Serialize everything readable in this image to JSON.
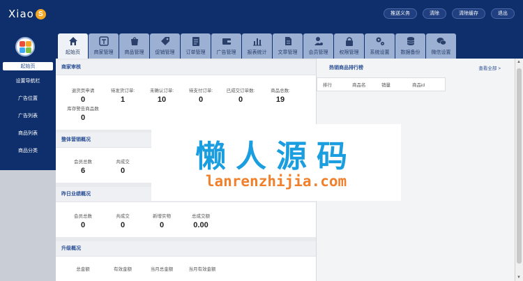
{
  "brand": {
    "name": "Xiao",
    "badge": "S"
  },
  "top_actions": [
    "推送义务",
    "清除",
    "清除缓存",
    "退出"
  ],
  "sidebar": {
    "items": [
      {
        "label": "起始页",
        "active": true
      },
      {
        "label": "设置导航栏",
        "active": false
      },
      {
        "label": "广告位置",
        "active": false
      },
      {
        "label": "广告列表",
        "active": false
      },
      {
        "label": "商品列表",
        "active": false
      },
      {
        "label": "商品分类",
        "active": false
      }
    ]
  },
  "tabs": [
    {
      "label": "起始页",
      "icon": "home-icon",
      "active": true
    },
    {
      "label": "商家管理",
      "icon": "shop-icon",
      "active": false
    },
    {
      "label": "商品管理",
      "icon": "shopping-bag-icon",
      "active": false
    },
    {
      "label": "促销管理",
      "icon": "tag-icon",
      "active": false
    },
    {
      "label": "订单管理",
      "icon": "clipboard-icon",
      "active": false
    },
    {
      "label": "广告管理",
      "icon": "wallet-icon",
      "active": false
    },
    {
      "label": "报表统计",
      "icon": "bar-chart-icon",
      "active": false
    },
    {
      "label": "文章管理",
      "icon": "document-icon",
      "active": false
    },
    {
      "label": "会员管理",
      "icon": "user-settings-icon",
      "active": false
    },
    {
      "label": "权限管理",
      "icon": "lock-icon",
      "active": false
    },
    {
      "label": "系统设置",
      "icon": "gears-icon",
      "active": false
    },
    {
      "label": "数据备份",
      "icon": "database-icon",
      "active": false
    },
    {
      "label": "微信设置",
      "icon": "wechat-icon",
      "active": false
    }
  ],
  "panels": {
    "shop": {
      "title": "商家审核",
      "stats": [
        {
          "label": "退货页申请",
          "value": "0"
        },
        {
          "label": "待发货订单:",
          "value": "1"
        },
        {
          "label": "未确认订单:",
          "value": "10"
        },
        {
          "label": "待支付订单:",
          "value": "0"
        },
        {
          "label": "已成交订单数:",
          "value": "0"
        },
        {
          "label": "商品总数:",
          "value": "19"
        },
        {
          "label": "库存警告商品数",
          "value": "0"
        }
      ]
    },
    "overall": {
      "title": "整体营销概况",
      "stats": [
        {
          "label": "会员总数",
          "value": "6"
        },
        {
          "label": "共成交",
          "value": "0"
        }
      ]
    },
    "yesterday": {
      "title": "昨日业绩概况",
      "stats": [
        {
          "label": "会员总数",
          "value": "0"
        },
        {
          "label": "共成交",
          "value": "0"
        },
        {
          "label": "新增实物",
          "value": "0"
        },
        {
          "label": "总成交额",
          "value": "0.00"
        }
      ]
    },
    "upgrade": {
      "title": "升级概况",
      "columns": [
        "总金额",
        "有效金额",
        "当月总金额",
        "当月有效金额"
      ]
    }
  },
  "ranking": {
    "title": "热销商品排行榜",
    "more": "查看全部 >",
    "columns": [
      "排行",
      "商品名",
      "销量",
      "商品id"
    ]
  },
  "watermark": {
    "cn": "懒人源码",
    "en": "lanrenzhijia.com"
  },
  "colors": {
    "header": "#0e2f6b",
    "tab": "#9bb0d3",
    "accent": "#2a4f95",
    "watermark_cn": "#1a9ee0",
    "watermark_en": "#f0802b"
  }
}
